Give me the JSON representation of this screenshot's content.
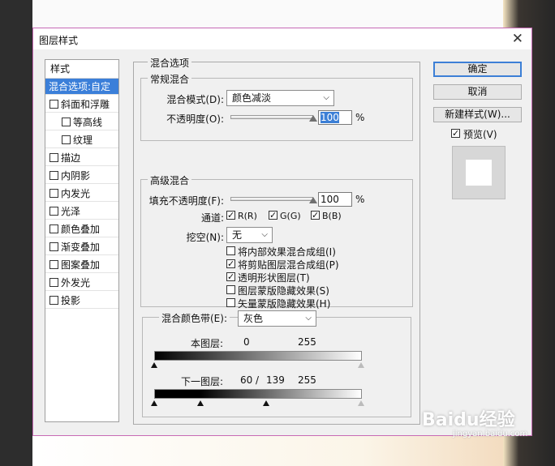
{
  "window": {
    "title": "图层样式",
    "close_glyph": "✕"
  },
  "styles_panel": {
    "header": "样式",
    "items": [
      {
        "label": "混合选项:自定",
        "checkbox": false,
        "selected": true,
        "indent": false
      },
      {
        "label": "斜面和浮雕",
        "checkbox": true,
        "checked": false,
        "indent": false
      },
      {
        "label": "等高线",
        "checkbox": true,
        "checked": false,
        "indent": true
      },
      {
        "label": "纹理",
        "checkbox": true,
        "checked": false,
        "indent": true
      },
      {
        "label": "描边",
        "checkbox": true,
        "checked": false,
        "indent": false
      },
      {
        "label": "内阴影",
        "checkbox": true,
        "checked": false,
        "indent": false
      },
      {
        "label": "内发光",
        "checkbox": true,
        "checked": false,
        "indent": false
      },
      {
        "label": "光泽",
        "checkbox": true,
        "checked": false,
        "indent": false
      },
      {
        "label": "颜色叠加",
        "checkbox": true,
        "checked": false,
        "indent": false
      },
      {
        "label": "渐变叠加",
        "checkbox": true,
        "checked": false,
        "indent": false
      },
      {
        "label": "图案叠加",
        "checkbox": true,
        "checked": false,
        "indent": false
      },
      {
        "label": "外发光",
        "checkbox": true,
        "checked": false,
        "indent": false
      },
      {
        "label": "投影",
        "checkbox": true,
        "checked": false,
        "indent": false
      }
    ]
  },
  "blend_options": {
    "title": "混合选项",
    "general": {
      "title": "常规混合",
      "blend_mode_label": "混合模式(D):",
      "blend_mode_value": "颜色减淡",
      "opacity_label": "不透明度(O):",
      "opacity_value": "100",
      "opacity_level": 1.0,
      "unit": "%"
    },
    "advanced": {
      "title": "高级混合",
      "fill_label": "填充不透明度(F):",
      "fill_value": "100",
      "fill_level": 1.0,
      "unit": "%",
      "channels_label": "通道:",
      "channels": [
        {
          "label": "R(R)",
          "checked": true
        },
        {
          "label": "G(G)",
          "checked": true
        },
        {
          "label": "B(B)",
          "checked": true
        }
      ],
      "knockout_label": "挖空(N):",
      "knockout_value": "无",
      "options": [
        {
          "label": "将内部效果混合成组(I)",
          "checked": false
        },
        {
          "label": "将剪贴图层混合成组(P)",
          "checked": true
        },
        {
          "label": "透明形状图层(T)",
          "checked": true
        },
        {
          "label": "图层蒙版隐藏效果(S)",
          "checked": false
        },
        {
          "label": "矢量蒙版隐藏效果(H)",
          "checked": false
        }
      ]
    },
    "blend_if": {
      "label": "混合颜色带(E):",
      "value": "灰色",
      "this_layer_label": "本图层:",
      "this_layer_low": "0",
      "this_layer_high": "255",
      "underlying_label": "下一图层:",
      "underlying_low": "60",
      "underlying_sep": "/",
      "underlying_mid": "139",
      "underlying_high": "255"
    }
  },
  "buttons": {
    "ok": "确定",
    "cancel": "取消",
    "new_style": "新建样式(W)...",
    "preview_label": "预览(V)",
    "preview_checked": true
  },
  "watermark": {
    "text": "Baidu经验",
    "sub": "jingyan.baidu.com"
  },
  "colors": {
    "accent": "#3b7fd9",
    "dialog_border": "#c76ab5",
    "background": "#f0f0f0"
  }
}
